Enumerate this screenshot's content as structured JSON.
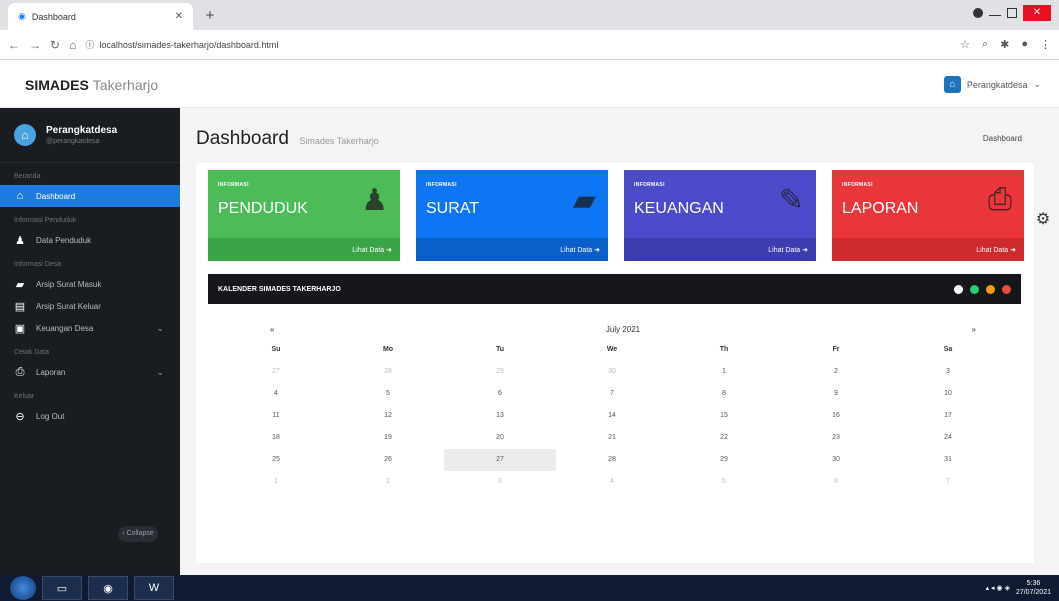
{
  "browser": {
    "tab_title": "Dashboard",
    "url": "localhost/simades-takerharjo/dashboard.html"
  },
  "header": {
    "brand_bold": "SIMADES",
    "brand_light": "Takerharjo",
    "user_name": "Perangkatdesa"
  },
  "sidebar": {
    "user_name": "Perangkatdesa",
    "user_role": "@perangkatdesa",
    "collapse_label": "Collapse",
    "sections": [
      {
        "heading": "Beranda",
        "items": [
          {
            "label": "Dashboard",
            "icon": "home-icon",
            "active": true
          }
        ]
      },
      {
        "heading": "Informasi Penduduk",
        "items": [
          {
            "label": "Data Penduduk",
            "icon": "user-icon"
          }
        ]
      },
      {
        "heading": "Informasi Desa",
        "items": [
          {
            "label": "Arsip Surat Masuk",
            "icon": "inbox-icon"
          },
          {
            "label": "Arsip Surat Keluar",
            "icon": "outbox-icon"
          },
          {
            "label": "Keuangan Desa",
            "icon": "money-icon",
            "expandable": true
          }
        ]
      },
      {
        "heading": "Cetak Data",
        "items": [
          {
            "label": "Laporan",
            "icon": "print-icon",
            "expandable": true
          }
        ]
      },
      {
        "heading": "Keluar",
        "items": [
          {
            "label": "Log Out",
            "icon": "logout-icon"
          }
        ]
      }
    ]
  },
  "main": {
    "title": "Dashboard",
    "subtitle": "Simades Takerharjo",
    "breadcrumb": "Dashboard"
  },
  "info_boxes": [
    {
      "small": "INFORMASI",
      "big": "PENDUDUK",
      "link": "Lihat Data",
      "color": "#4cbb58",
      "icon": "user-icon"
    },
    {
      "small": "INFORMASI",
      "big": "SURAT",
      "link": "Lihat Data",
      "color": "#0e76f3",
      "icon": "book-icon"
    },
    {
      "small": "INFORMASI",
      "big": "KEUANGAN",
      "link": "Lihat Data",
      "color": "#4c4bc9",
      "icon": "pencil-icon"
    },
    {
      "small": "INFORMASI",
      "big": "LAPORAN",
      "link": "Lihat Data",
      "color": "#e8363a",
      "icon": "print-icon"
    }
  ],
  "calendar": {
    "header": "KALENDER SIMADES TAKERHARJO",
    "month": "July 2021",
    "prev": "«",
    "next": "»",
    "dow": [
      "Su",
      "Mo",
      "Tu",
      "We",
      "Th",
      "Fr",
      "Sa"
    ],
    "weeks": [
      [
        "27",
        "28",
        "29",
        "30",
        "1",
        "2",
        "3"
      ],
      [
        "4",
        "5",
        "6",
        "7",
        "8",
        "9",
        "10"
      ],
      [
        "11",
        "12",
        "13",
        "14",
        "15",
        "16",
        "17"
      ],
      [
        "18",
        "19",
        "20",
        "21",
        "22",
        "23",
        "24"
      ],
      [
        "25",
        "26",
        "27",
        "28",
        "29",
        "30",
        "31"
      ],
      [
        "1",
        "2",
        "3",
        "4",
        "5",
        "6",
        "7"
      ]
    ],
    "dot_colors": [
      "#ffffff",
      "#2ecc71",
      "#f39c12",
      "#e74c3c"
    ]
  },
  "taskbar": {
    "time": "5:36",
    "date": "27/07/2021"
  }
}
